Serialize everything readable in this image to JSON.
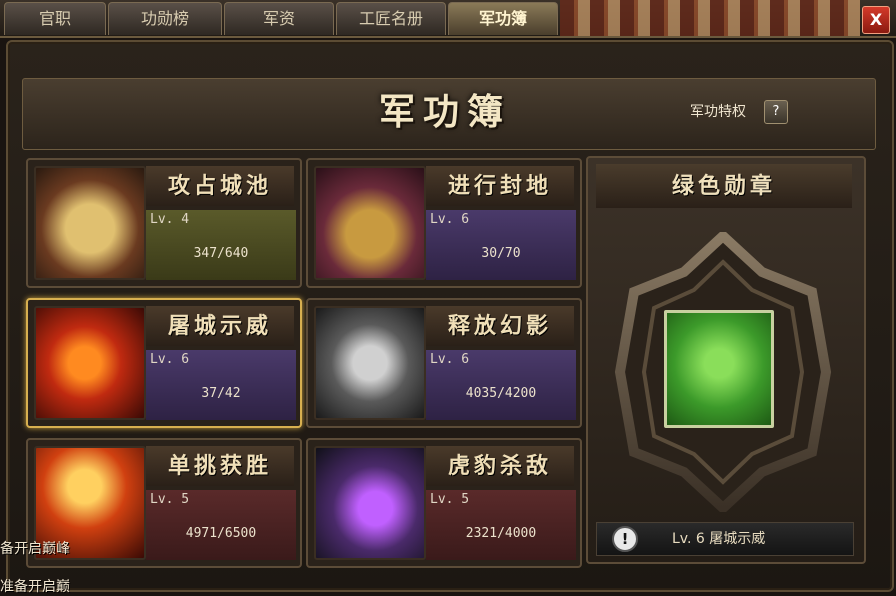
{
  "tabs": [
    {
      "label": "官职",
      "active": false
    },
    {
      "label": "功勋榜",
      "active": false
    },
    {
      "label": "军资",
      "active": false
    },
    {
      "label": "工匠名册",
      "active": false
    },
    {
      "label": "军功簿",
      "active": true
    }
  ],
  "close_label": "X",
  "page_title": "军功簿",
  "privilege_label": "军功特权",
  "help_label": "?",
  "achievements": [
    {
      "name": "攻占城池",
      "level": "Lv. 4",
      "progress": "347/640",
      "icon": "scroll-flag-icon",
      "panel_color": "olive",
      "selected": false
    },
    {
      "name": "进行封地",
      "level": "Lv. 6",
      "progress": "30/70",
      "icon": "golden-seal-icon",
      "panel_color": "purple",
      "selected": false
    },
    {
      "name": "屠城示威",
      "level": "Lv. 6",
      "progress": "37/42",
      "icon": "warrior-icon",
      "panel_color": "purple",
      "selected": true
    },
    {
      "name": "释放幻影",
      "level": "Lv. 6",
      "progress": "4035/4200",
      "icon": "phantom-horse-icon",
      "panel_color": "purple",
      "selected": false
    },
    {
      "name": "单挑获胜",
      "level": "Lv. 5",
      "progress": "4971/6500",
      "icon": "duel-battle-icon",
      "panel_color": "maroon",
      "selected": false
    },
    {
      "name": "虎豹杀敌",
      "level": "Lv. 5",
      "progress": "2321/4000",
      "icon": "spear-strike-icon",
      "panel_color": "maroon",
      "selected": false
    }
  ],
  "medal": {
    "title": "绿色勋章",
    "alert_icon": "!",
    "status": "Lv. 6  屠城示威"
  },
  "overlay_texts": [
    "备开启巅峰",
    "准备开启巅"
  ]
}
